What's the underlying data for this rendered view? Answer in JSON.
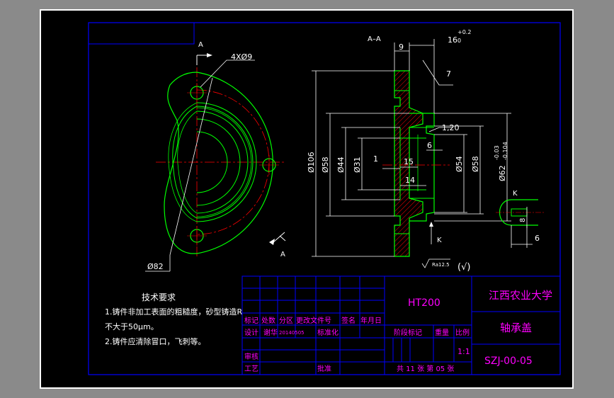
{
  "colors": {
    "background": "#000000",
    "outer_area": "#8a8a8a",
    "frame": "#0000ff",
    "part_outline": "#00ff00",
    "dimension": "#ffffff",
    "center_line": "#ff0000",
    "section_hatch": "#ff0000",
    "title_text": "#ff00ff"
  },
  "drawing": {
    "section_label": "A–A",
    "view_label_a_top": "A",
    "view_label_a_bottom": "A",
    "view_label_k_arrow": "K",
    "detail_label_k": "K",
    "hole_callout": "4XØ9",
    "pcd_callout": "Ø82",
    "roughness_note": "Ra12.5",
    "roughness_other": "(√)"
  },
  "dimensions": {
    "d_outer": "Ø106",
    "d_58_left": "Ø58",
    "d_44": "Ø44",
    "d_31": "Ø31",
    "d_54": "Ø54",
    "d_58_right": "Ø58",
    "d_62": "Ø62",
    "d_62_tol_upper": "-0.03",
    "d_62_tol_lower": "-0.104",
    "dim_16": "16",
    "dim_16_tol_upper": "+0.2",
    "dim_16_tol_lower": "0",
    "dim_9": "9",
    "dim_7": "7",
    "dim_1": "1",
    "dim_15": "15",
    "dim_14": "14",
    "dim_6_section": "6",
    "chamfer": "1,20",
    "detail_8": "8",
    "detail_6": "6"
  },
  "technical_requirements": {
    "heading": "技术要求",
    "line1": "1.铸件非加工表面的粗糙度，砂型铸造R",
    "line2": "不大于50μm。",
    "line3": "2.铸件应清除冒口，飞刺等。"
  },
  "title_block": {
    "material": "HT200",
    "school": "江西农业大学",
    "part_name": "轴承盖",
    "drawing_number": "SZJ-00-05",
    "header_row": [
      "标记",
      "处数",
      "分区",
      "更改文件号",
      "签名",
      "年月日"
    ],
    "design_label": "设计",
    "designer": "谢华",
    "design_date": "20140505",
    "standardization": "标准化",
    "stage_mark": "阶段标记",
    "weight": "重量",
    "scale_label": "比例",
    "scale_value": "1:1",
    "review": "审核",
    "process": "工艺",
    "approve": "批准",
    "sheets": "共 11 张 第 05 张"
  }
}
